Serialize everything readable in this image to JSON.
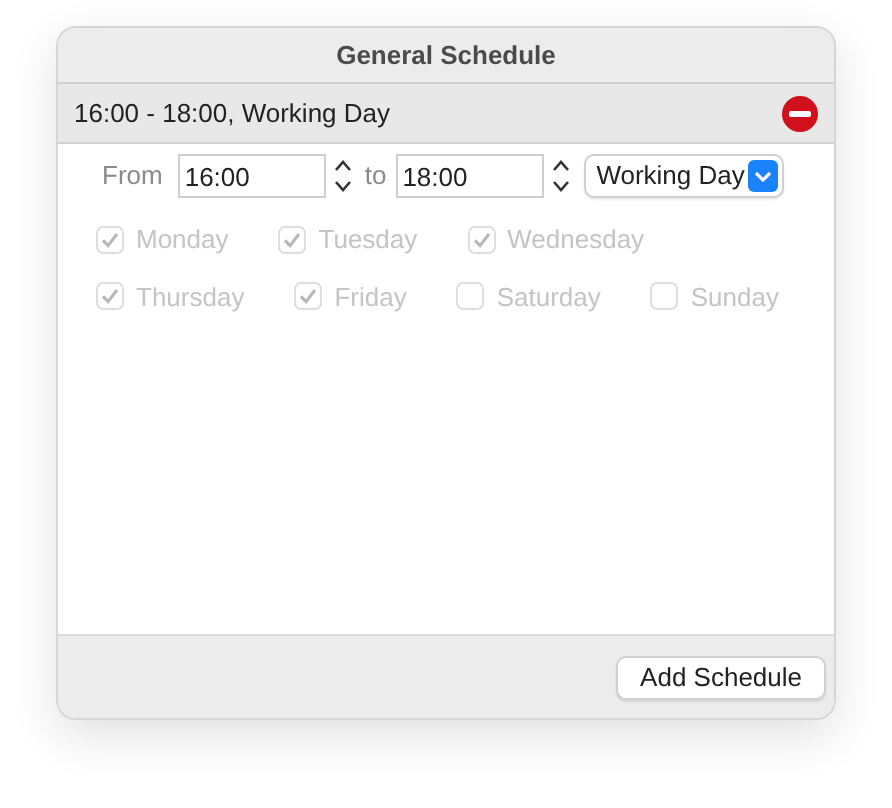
{
  "window": {
    "title": "General Schedule"
  },
  "schedule": {
    "summary": "16:00 - 18:00, Working Day",
    "from_label": "From",
    "from": "16:00",
    "to_label": "to",
    "to": "18:00",
    "day_type": "Working Day"
  },
  "day_rows": [
    [
      {
        "label": "Monday",
        "checked": true,
        "disabled": true
      },
      {
        "label": "Tuesday",
        "checked": true,
        "disabled": true
      },
      {
        "label": "Wednesday",
        "checked": true,
        "disabled": true
      }
    ],
    [
      {
        "label": "Thursday",
        "checked": true,
        "disabled": true
      },
      {
        "label": "Friday",
        "checked": true,
        "disabled": true
      },
      {
        "label": "Saturday",
        "checked": false,
        "disabled": true
      },
      {
        "label": "Sunday",
        "checked": false,
        "disabled": true
      }
    ]
  ],
  "buttons": [
    "Add Schedule"
  ]
}
